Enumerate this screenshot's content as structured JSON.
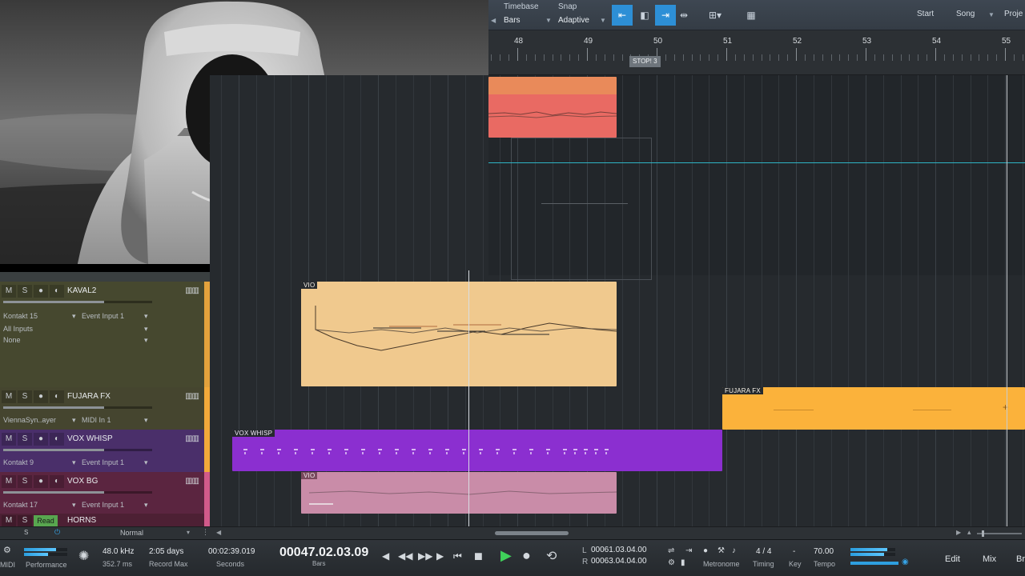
{
  "toolbar": {
    "timebase_label": "Timebase",
    "timebase_value": "Bars",
    "snap_label": "Snap",
    "snap_value": "Adaptive",
    "start_label": "Start",
    "song_label": "Song",
    "project_label": "Proje"
  },
  "ruler": {
    "bars": [
      "48",
      "49",
      "50",
      "51",
      "52",
      "53",
      "54",
      "55"
    ],
    "marker_label": "STOP! 3"
  },
  "tracks": [
    {
      "name": "KAVAL2",
      "color": "#e3a23c",
      "bg": "#46482f",
      "instrument": "Kontakt 15",
      "input": "Event Input 1",
      "input2": "All Inputs",
      "output": "None",
      "fader": 0.68
    },
    {
      "name": "FUJARA FX",
      "color": "#f2a93a",
      "bg": "#45452f",
      "instrument": "ViennaSyn..ayer",
      "input": "MIDI In 1",
      "fader": 0.68
    },
    {
      "name": "VOX WHISP",
      "color": "#f2a93a",
      "bg": "#4a2f6a",
      "instrument": "Kontakt 9",
      "input": "Event Input 1",
      "fader": 0.68
    },
    {
      "name": "VOX BG",
      "color": "#d15a8a",
      "bg": "#5b2540",
      "instrument": "Kontakt 17",
      "input": "Event Input 1",
      "fader": 0.68
    },
    {
      "name": "HORNS",
      "color": "#d15a8a",
      "bg": "#4d2034",
      "read_label": "Read",
      "mode": "Normal"
    }
  ],
  "clips": {
    "top_clip_color": "#e96a63",
    "vio": {
      "title": "VIO",
      "color": "#f0c98e"
    },
    "fujara": {
      "title": "FUJARA FX",
      "color": "#fbb23b"
    },
    "vox_whisp": {
      "title": "VOX WHISP",
      "color": "#8b2fd0"
    },
    "vox_bg": {
      "title": "VIO",
      "color": "#c98ca8"
    }
  },
  "transport": {
    "midi_label": "MIDI",
    "performance_label": "Performance",
    "sample_rate": "48.0 kHz",
    "latency": "352.7 ms",
    "record_days": "2:05 days",
    "record_max_label": "Record Max",
    "seconds_value": "00:02:39.019",
    "seconds_label": "Seconds",
    "position": "00047.02.03.09",
    "bars_label": "Bars",
    "loop_l_label": "L",
    "loop_l": "00061.03.04.00",
    "loop_r_label": "R",
    "loop_r": "00063.04.04.00",
    "metronome_label": "Metronome",
    "timing_value": "4 / 4",
    "timing_label": "Timing",
    "key_value": "-",
    "key_label": "Key",
    "tempo_value": "70.00",
    "tempo_label": "Tempo",
    "edit_label": "Edit",
    "mix_label": "Mix",
    "browse_label": "Br"
  }
}
